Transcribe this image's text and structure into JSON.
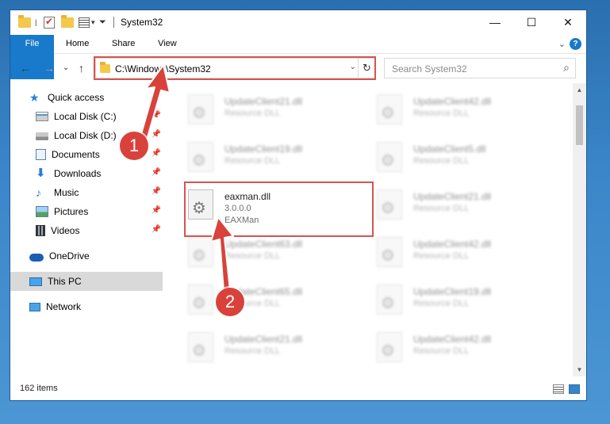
{
  "window": {
    "title": "System32",
    "qa_pin": "|",
    "qa_dropdown": "▾",
    "minimize": "—",
    "maximize": "☐",
    "close": "✕"
  },
  "ribbon": {
    "tabs": [
      "File",
      "Home",
      "Share",
      "View"
    ],
    "collapse": "⌄",
    "help": "?"
  },
  "nav": {
    "back": "←",
    "forward": "→",
    "recent": "⌄",
    "up": "↑",
    "address": "C:\\Windows\\System32",
    "address_dropdown": "⌄",
    "refresh": "↻",
    "search_placeholder": "Search System32",
    "search_icon": "🔍"
  },
  "sidebar": {
    "items": [
      {
        "label": "Quick access",
        "icon": "star-icon",
        "pin": ""
      },
      {
        "label": "Local Disk (C:)",
        "icon": "drive-icon",
        "pin": "📌"
      },
      {
        "label": "Local Disk (D:)",
        "icon": "drive-icon",
        "pin": "📌"
      },
      {
        "label": "Documents",
        "icon": "documents-icon",
        "pin": "📌"
      },
      {
        "label": "Downloads",
        "icon": "downloads-icon",
        "pin": "📌"
      },
      {
        "label": "Music",
        "icon": "music-icon",
        "pin": "📌"
      },
      {
        "label": "Pictures",
        "icon": "pictures-icon",
        "pin": "📌"
      },
      {
        "label": "Videos",
        "icon": "videos-icon",
        "pin": "📌"
      },
      {
        "label": "OneDrive",
        "icon": "onedrive-icon",
        "pin": ""
      },
      {
        "label": "This PC",
        "icon": "pc-icon",
        "pin": ""
      },
      {
        "label": "Network",
        "icon": "network-icon",
        "pin": ""
      }
    ]
  },
  "files": {
    "left": [
      {
        "name": "UpdateClient21.dll",
        "type": "Resource DLL"
      },
      {
        "name": "UpdateClient19.dll",
        "type": "Resource DLL"
      },
      {
        "name": "UpdateClient63.dll",
        "type": "Resource DLL"
      },
      {
        "name": "UpdateClient65.dll",
        "type": "Resource DLL"
      },
      {
        "name": "UpdateClient21.dll",
        "type": "Resource DLL"
      }
    ],
    "right": [
      {
        "name": "UpdateClient42.dll",
        "type": "Resource DLL"
      },
      {
        "name": "UpdateClient5.dll",
        "type": "Resource DLL"
      },
      {
        "name": "UpdateClient21.dll",
        "type": "Resource DLL"
      },
      {
        "name": "UpdateClient42.dll",
        "type": "Resource DLL"
      },
      {
        "name": "UpdateClient19.dll",
        "type": "Resource DLL"
      },
      {
        "name": "UpdateClient42.dll",
        "type": "Resource DLL"
      }
    ],
    "highlighted": {
      "name": "eaxman.dll",
      "version": "3.0.0.0",
      "description": "EAXMan"
    }
  },
  "scrollbar": {
    "up": "▲",
    "down": "▼"
  },
  "status": {
    "count": "162 items"
  },
  "callouts": {
    "one": "1",
    "two": "2"
  },
  "colors": {
    "accent": "#1979ca",
    "highlight": "#d9534f"
  }
}
